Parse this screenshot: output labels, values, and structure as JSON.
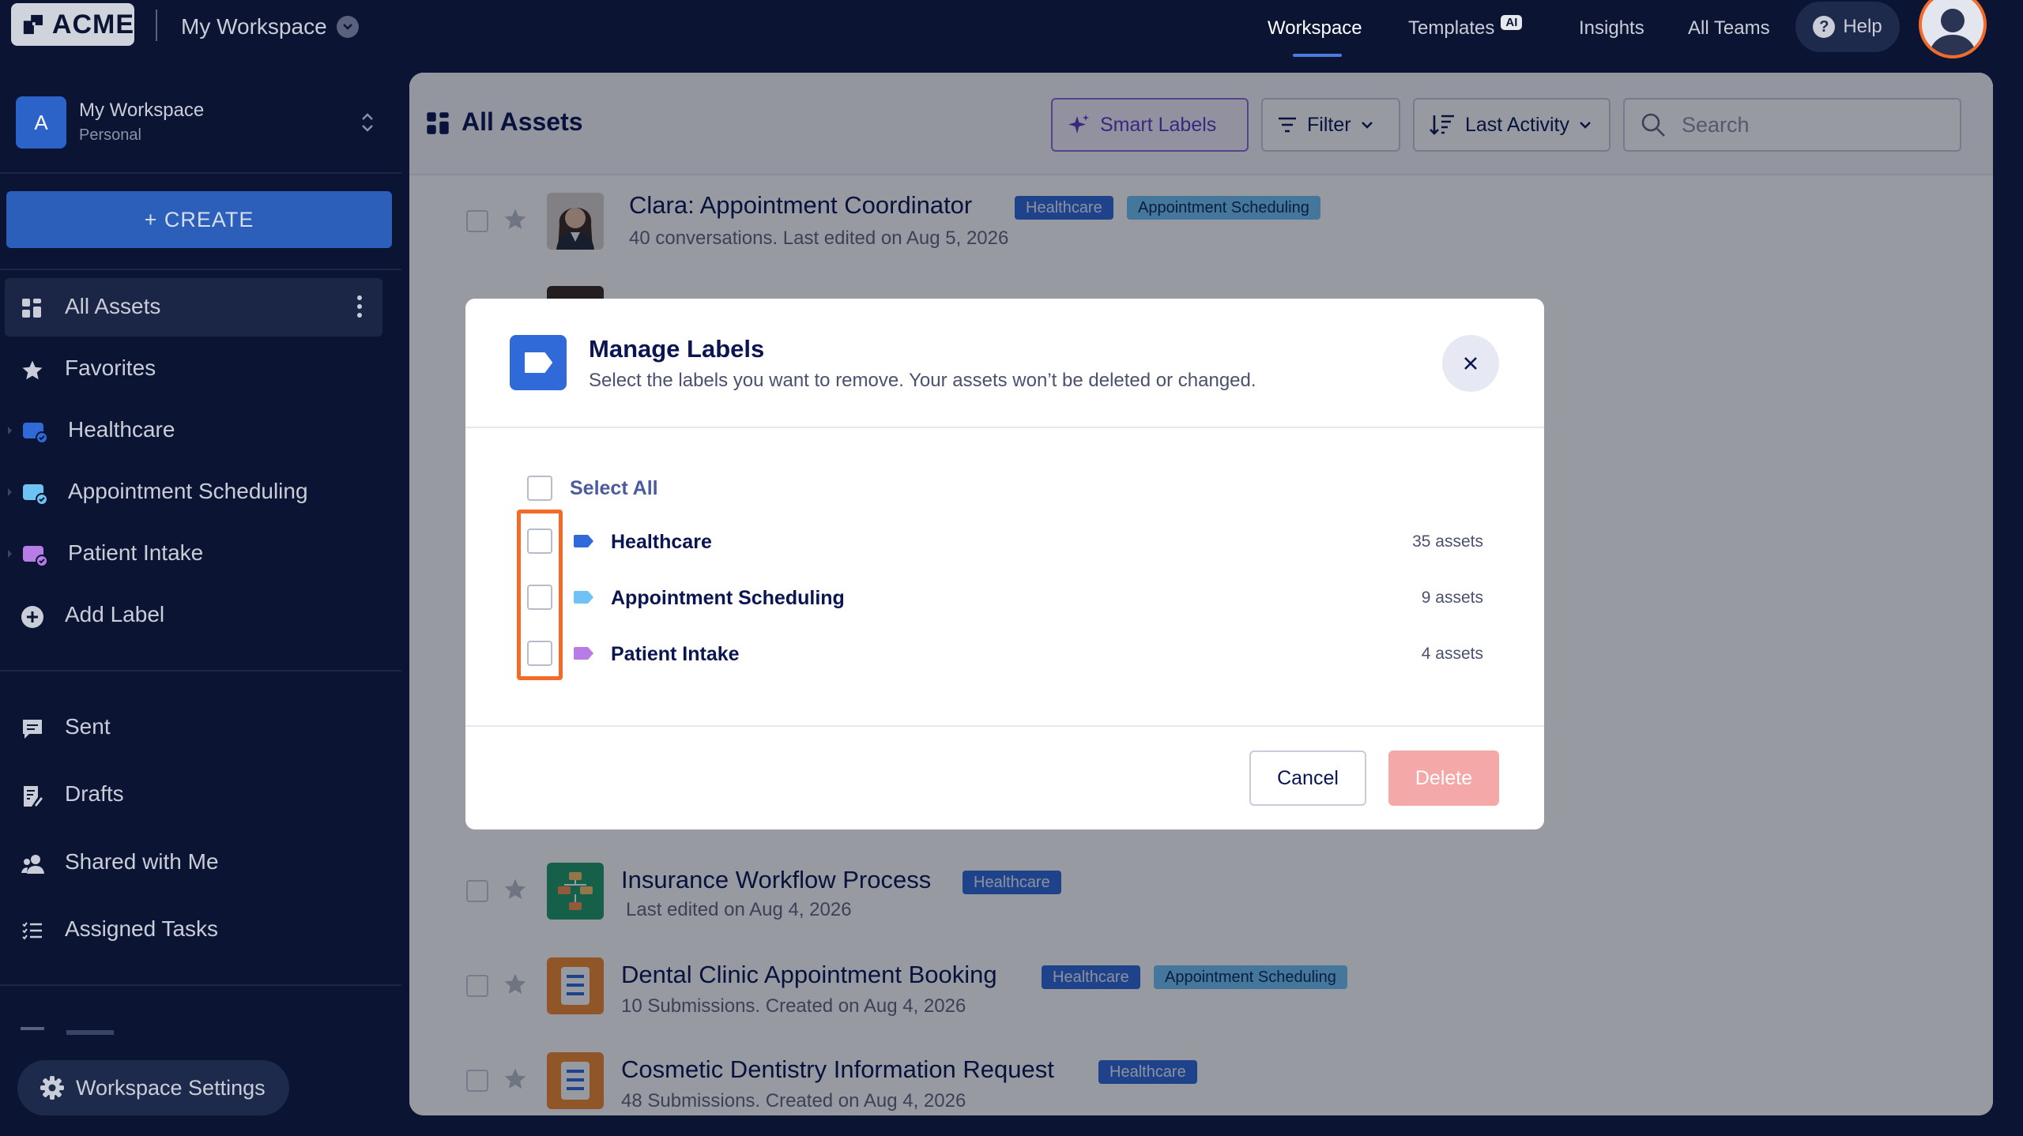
{
  "topbar": {
    "logo_text": "ACME",
    "workspace_name": "My Workspace",
    "nav": {
      "workspace": "Workspace",
      "templates": "Templates",
      "templates_badge": "AI",
      "insights": "Insights",
      "all_teams": "All Teams"
    },
    "help_label": "Help"
  },
  "sidebar": {
    "workspace": {
      "initial": "A",
      "name": "My Workspace",
      "type": "Personal"
    },
    "create_label": "+ CREATE",
    "items": [
      {
        "label": "All Assets",
        "icon": "grid-icon"
      },
      {
        "label": "Favorites",
        "icon": "star-icon"
      },
      {
        "label": "Healthcare",
        "icon": "label-folder-icon",
        "color": "#2f6ad8"
      },
      {
        "label": "Appointment Scheduling",
        "icon": "label-folder-icon",
        "color": "#6fc3f4"
      },
      {
        "label": "Patient Intake",
        "icon": "label-folder-icon",
        "color": "#b77ce6"
      },
      {
        "label": "Add Label",
        "icon": "plus-circle-icon"
      }
    ],
    "secondary_items": [
      {
        "label": "Sent",
        "icon": "chat-icon"
      },
      {
        "label": "Drafts",
        "icon": "draft-icon"
      },
      {
        "label": "Shared with Me",
        "icon": "users-icon"
      },
      {
        "label": "Assigned Tasks",
        "icon": "tasks-icon"
      }
    ],
    "settings_label": "Workspace Settings"
  },
  "main": {
    "title": "All Assets",
    "smart_labels": "Smart Labels",
    "filter": "Filter",
    "sort": "Last Activity",
    "search_placeholder": "Search",
    "assets": [
      {
        "title": "Clara: Appointment Coordinator",
        "subtitle": "40 conversations. Last edited on Aug 5, 2026",
        "tags": [
          "Healthcare",
          "Appointment Scheduling"
        ]
      },
      {
        "title": "Insurance Workflow Process",
        "subtitle": "Last edited on Aug 4, 2026",
        "tags": [
          "Healthcare"
        ]
      },
      {
        "title": "Dental Clinic Appointment Booking",
        "subtitle": "10 Submissions. Created on Aug 4, 2026",
        "tags": [
          "Healthcare",
          "Appointment Scheduling"
        ]
      },
      {
        "title": "Cosmetic Dentistry Information Request",
        "subtitle": "48 Submissions. Created on Aug 4, 2026",
        "tags": [
          "Healthcare"
        ]
      }
    ]
  },
  "modal": {
    "title": "Manage Labels",
    "description": "Select the labels you want to remove. Your assets won’t be deleted or changed.",
    "select_all": "Select All",
    "labels": [
      {
        "name": "Healthcare",
        "count": "35 assets",
        "color": "#2f6ad8"
      },
      {
        "name": "Appointment Scheduling",
        "count": "9 assets",
        "color": "#6fc3f4"
      },
      {
        "name": "Patient Intake",
        "count": "4 assets",
        "color": "#b77ce6"
      }
    ],
    "cancel_label": "Cancel",
    "delete_label": "Delete"
  }
}
